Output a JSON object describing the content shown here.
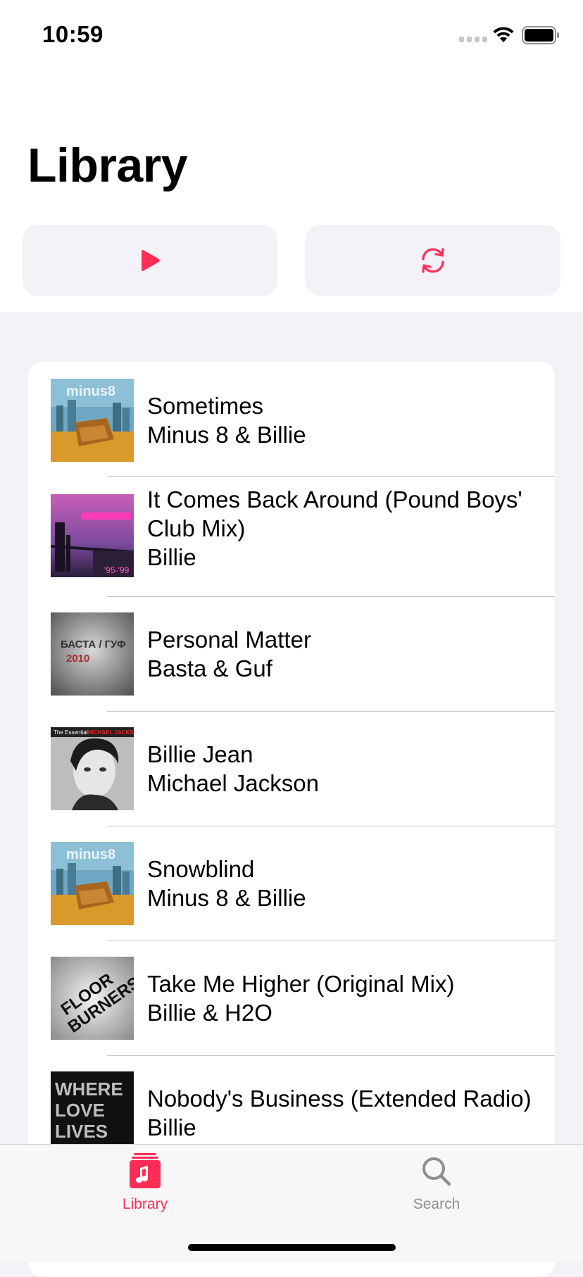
{
  "status_bar": {
    "time": "10:59",
    "signal_icon": "cellular-signal-icon",
    "wifi_icon": "wifi-icon",
    "battery_icon": "battery-icon"
  },
  "header": {
    "title": "Library"
  },
  "actions": {
    "play_icon": "play-icon",
    "sync_icon": "sync-icon"
  },
  "colors": {
    "accent": "#ff2d55",
    "background": "#f2f2f7",
    "separator": "#c6c6c8",
    "inactive": "#8e8e93"
  },
  "songs": [
    {
      "title": "Sometimes",
      "artist": "Minus 8 & Billie",
      "artwork": "city-armchair-artwork"
    },
    {
      "title": "It Comes Back Around (Pound Boys' Club Mix)",
      "artist": "Billie",
      "artwork": "bridge-skyline-artwork"
    },
    {
      "title": "Personal Matter",
      "artist": "Basta & Guf",
      "artwork_text": "БАСТА / ГУФ\n2010",
      "artwork": "grey-stone-artwork"
    },
    {
      "title": "Billie Jean",
      "artist": "Michael Jackson",
      "artwork_text": "The Essential MICHAEL JACKSON",
      "artwork": "portrait-artwork"
    },
    {
      "title": "Snowblind",
      "artist": "Minus 8 & Billie",
      "artwork": "city-armchair-artwork"
    },
    {
      "title": "Take Me Higher (Original Mix)",
      "artist": "Billie & H2O",
      "artwork_text": "FLOOR BURNERS",
      "artwork": "floor-burners-artwork"
    },
    {
      "title": "Nobody's Business (Extended Radio)",
      "artist": "Billie",
      "artwork_text": "WHERE LOVE LIVES",
      "artwork": "where-love-lives-artwork"
    }
  ],
  "tab_bar": {
    "tabs": [
      {
        "label": "Library",
        "icon": "music-library-icon",
        "active": true
      },
      {
        "label": "Search",
        "icon": "search-icon",
        "active": false
      }
    ]
  }
}
